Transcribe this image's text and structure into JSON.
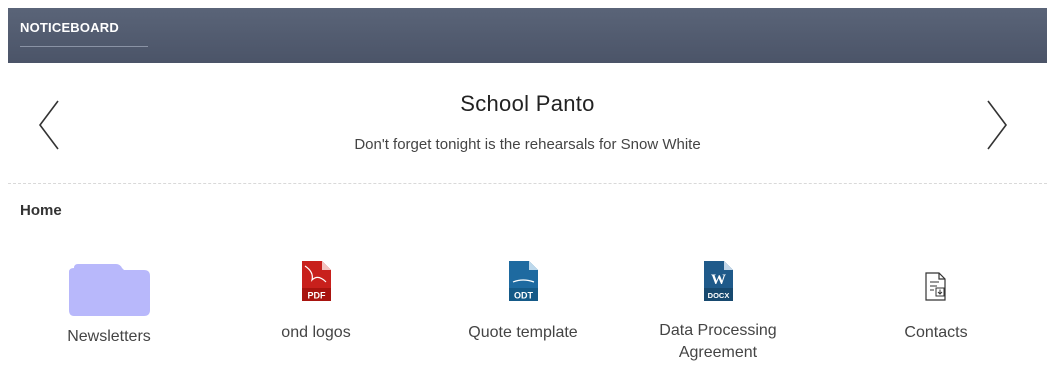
{
  "header": {
    "tab_label": "NOTICEBOARD"
  },
  "notice": {
    "title": "School Panto",
    "message": "Don't forget tonight is the rehearsals for Snow White"
  },
  "section": {
    "title": "Home"
  },
  "files": [
    {
      "label": "Newsletters",
      "icon": "folder-icon",
      "color": "#b8b8fb"
    },
    {
      "label": "ond logos",
      "icon": "pdf-file-icon",
      "badge": "PDF",
      "color": "#c8201c"
    },
    {
      "label": "Quote template",
      "icon": "odt-file-icon",
      "badge": "ODT",
      "color": "#1e6aa0"
    },
    {
      "label": "Data Processing Agreement",
      "icon": "docx-file-icon",
      "badge": "DOCX",
      "color": "#1f5a8a"
    },
    {
      "label": "Contacts",
      "icon": "contacts-file-icon"
    }
  ]
}
